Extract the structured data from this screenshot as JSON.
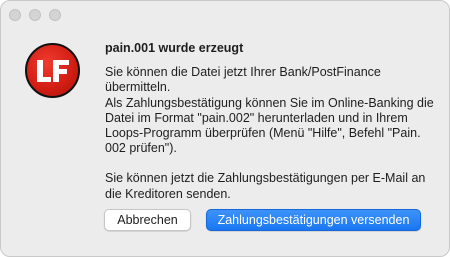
{
  "window": {
    "controls": [
      "close",
      "minimize",
      "zoom"
    ]
  },
  "logo": {
    "text": "LF",
    "color": "#d41f14"
  },
  "dialog": {
    "title": "pain.001 wurde erzeugt",
    "paragraph1": "Sie können die Datei jetzt Ihrer Bank/PostFinance übermitteln.",
    "paragraph2": "Als Zahlungsbestätigung können Sie im Online-Banking die Datei im Format \"pain.002\" herunterladen und in Ihrem Loops-Programm überprüfen (Menü \"Hilfe\", Befehl \"Pain. 002 prüfen\").",
    "paragraph3": "Sie können jetzt die Zahlungsbestätigungen per E-Mail an die Kreditoren senden."
  },
  "buttons": {
    "cancel_label": "Abbrechen",
    "send_label": "Zahlungsbestätigungen versenden",
    "accent_color": "#1a76f2"
  }
}
